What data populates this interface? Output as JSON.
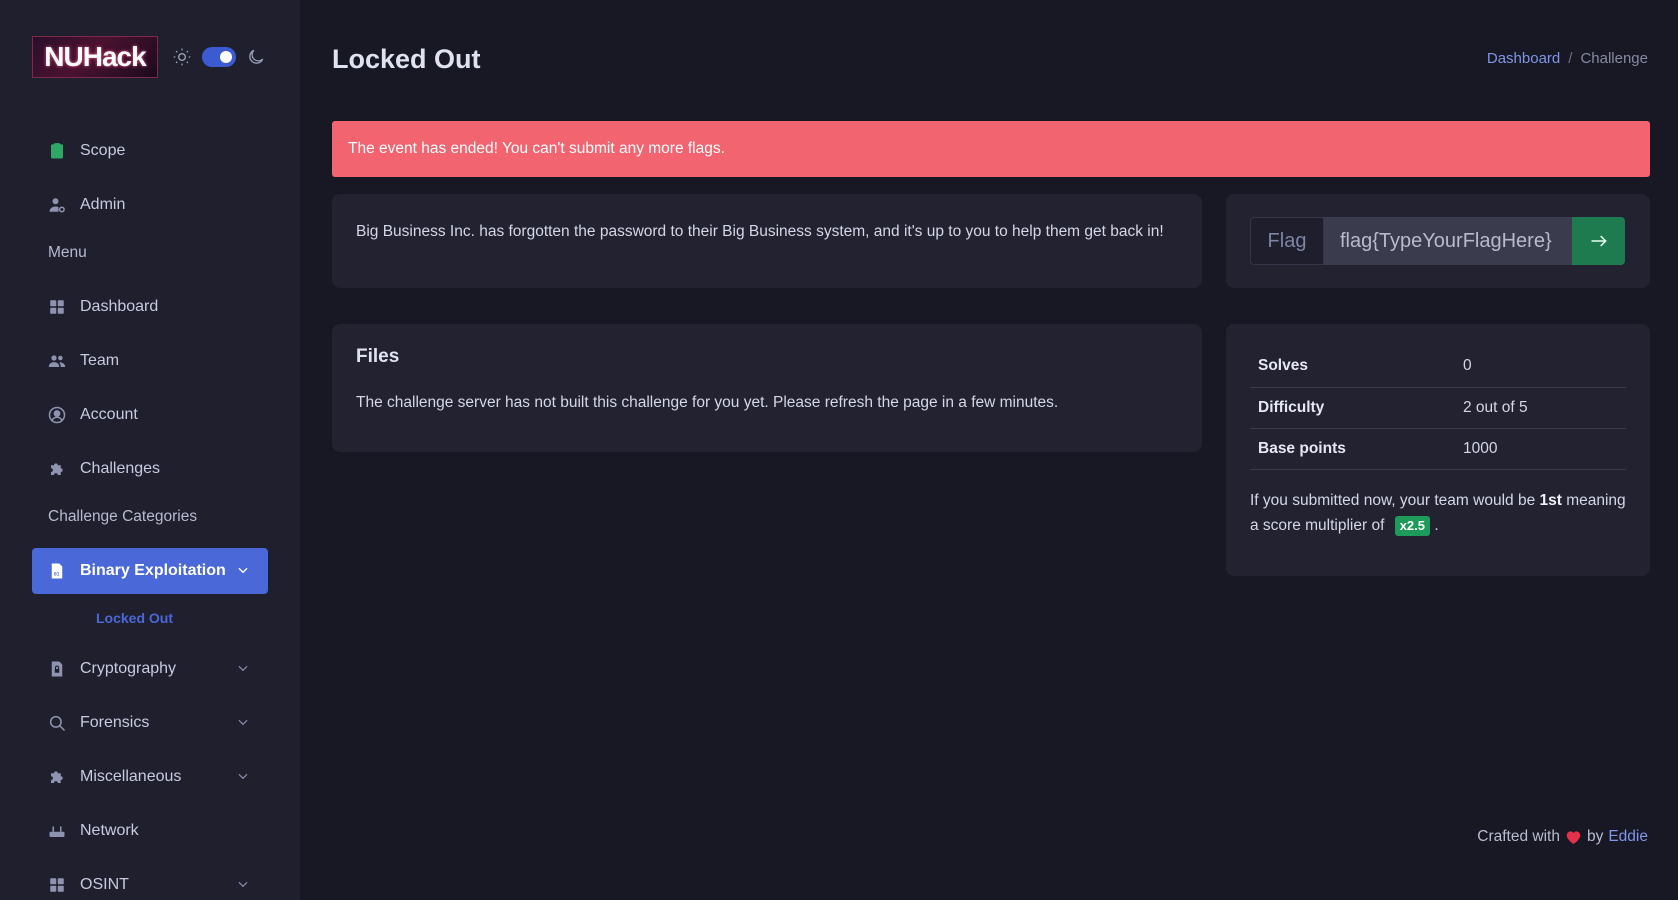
{
  "brand": {
    "logo_text": "NUHack"
  },
  "sidebar": {
    "top_items": [
      {
        "label": "Scope",
        "icon": "clipboard-icon"
      },
      {
        "label": "Admin",
        "icon": "user-cog-icon"
      }
    ],
    "menu_heading": "Menu",
    "menu_items": [
      {
        "label": "Dashboard",
        "icon": "grid-icon"
      },
      {
        "label": "Team",
        "icon": "users-icon"
      },
      {
        "label": "Account",
        "icon": "user-circle-icon"
      },
      {
        "label": "Challenges",
        "icon": "puzzle-icon"
      }
    ],
    "categories_heading": "Challenge Categories",
    "categories": [
      {
        "label": "Binary Exploitation",
        "icon": "binary-file-icon",
        "active": true,
        "sub_items": [
          "Locked Out"
        ]
      },
      {
        "label": "Cryptography",
        "icon": "lock-file-icon"
      },
      {
        "label": "Forensics",
        "icon": "search-icon"
      },
      {
        "label": "Miscellaneous",
        "icon": "puzzle-icon"
      },
      {
        "label": "Network",
        "icon": "router-icon"
      },
      {
        "label": "OSINT",
        "icon": "grid-icon"
      }
    ]
  },
  "header": {
    "title": "Locked Out",
    "breadcrumb": {
      "link": "Dashboard",
      "separator": "/",
      "current": "Challenge"
    }
  },
  "alert": {
    "text": "The event has ended! You can't submit any more flags."
  },
  "challenge": {
    "description": "Big Business Inc. has forgotten the password to their Big Business system, and it's up to you to help them get back in!"
  },
  "flag_form": {
    "label": "Flag",
    "placeholder": "flag{TypeYourFlagHere}",
    "submit_icon": "arrow-right-icon"
  },
  "files": {
    "title": "Files",
    "message": "The challenge server has not built this challenge for you yet. Please refresh the page in a few minutes."
  },
  "stats": {
    "rows": [
      {
        "key": "Solves",
        "value": "0"
      },
      {
        "key": "Difficulty",
        "value": "2 out of 5"
      },
      {
        "key": "Base points",
        "value": "1000"
      }
    ],
    "note_prefix": "If you submitted now, your team would be",
    "rank": "1st",
    "note_middle": "meaning a score multiplier of",
    "multiplier": "x2.5",
    "note_suffix": "."
  },
  "footer": {
    "prefix": "Crafted with",
    "by": "by",
    "author": "Eddie"
  },
  "colors": {
    "accent": "#4a68d8",
    "alert": "#f2646f",
    "success": "#1e7a4f",
    "badge": "#1e9a5a"
  }
}
